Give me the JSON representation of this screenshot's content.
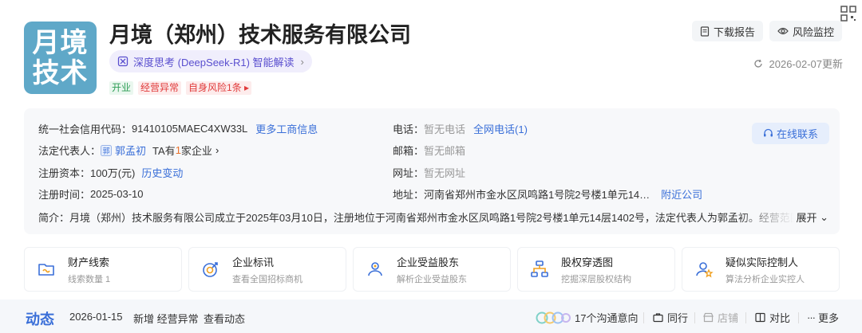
{
  "company": {
    "logo_line1": "月境",
    "logo_line2": "技术",
    "name": "月境（郑州）技术服务有限公司",
    "ai_label": "深度思考 (DeepSeek-R1) 智能解读",
    "tags": [
      "开业",
      "经营异常",
      "自身风险1条"
    ]
  },
  "toolbar": {
    "download_label": "下载报告",
    "monitor_label": "风险监控",
    "updated": "2026-02-07更新"
  },
  "info": {
    "credit_code_label": "统一社会信用代码：",
    "credit_code": "91410105MAEC4XW33L",
    "more_info_link": "更多工商信息",
    "legal_rep_label": "法定代表人：",
    "legal_rep_badge": "郭",
    "legal_rep_name": "郭孟初",
    "legal_rep_ta": "TA有",
    "legal_rep_count": "1",
    "legal_rep_suffix": "家企业",
    "capital_label": "注册资本：",
    "capital": "100万(元)",
    "history_link": "历史变动",
    "reg_time_label": "注册时间：",
    "reg_time": "2025-03-10",
    "phone_label": "电话：",
    "phone": "暂无电话",
    "phone_link": "全网电话(1)",
    "email_label": "邮箱：",
    "email": "暂无邮箱",
    "website_label": "网址：",
    "website": "暂无网址",
    "address_label": "地址：",
    "address": "河南省郑州市金水区凤鸣路1号院2号楼1单元14…",
    "nearby_link": "附近公司",
    "online_contact": "在线联系",
    "intro_label": "简介：",
    "intro": "月境（郑州）技术服务有限公司成立于2025年03月10日，注册地位于河南省郑州市金水区凤鸣路1号院2号楼1单元14层1402号，法定代表人为郭孟初。经营范围",
    "expand": "展开"
  },
  "features": [
    {
      "title": "财产线索",
      "sub": "线索数量 1",
      "icon": "property-icon"
    },
    {
      "title": "企业标讯",
      "sub": "查看全国招标商机",
      "icon": "bid-icon"
    },
    {
      "title": "企业受益股东",
      "sub": "解析企业受益股东",
      "icon": "shareholder-icon"
    },
    {
      "title": "股权穿透图",
      "sub": "挖掘深层股权结构",
      "icon": "equity-icon"
    },
    {
      "title": "疑似实际控制人",
      "sub": "算法分析企业实控人",
      "icon": "controller-icon"
    }
  ],
  "dynamics": {
    "title": "动态",
    "date": "2026-01-15",
    "text": "新增 经营异常",
    "link": "查看动态",
    "intent": "17个沟通意向",
    "peer": "同行",
    "shop": "店铺",
    "compare": "对比",
    "more": "更多"
  },
  "colors": {
    "accent": "#3a6fd8",
    "logo_bg": "#5fa8c8",
    "tag_green": "#2e9e56",
    "tag_red": "#e03b3b"
  }
}
